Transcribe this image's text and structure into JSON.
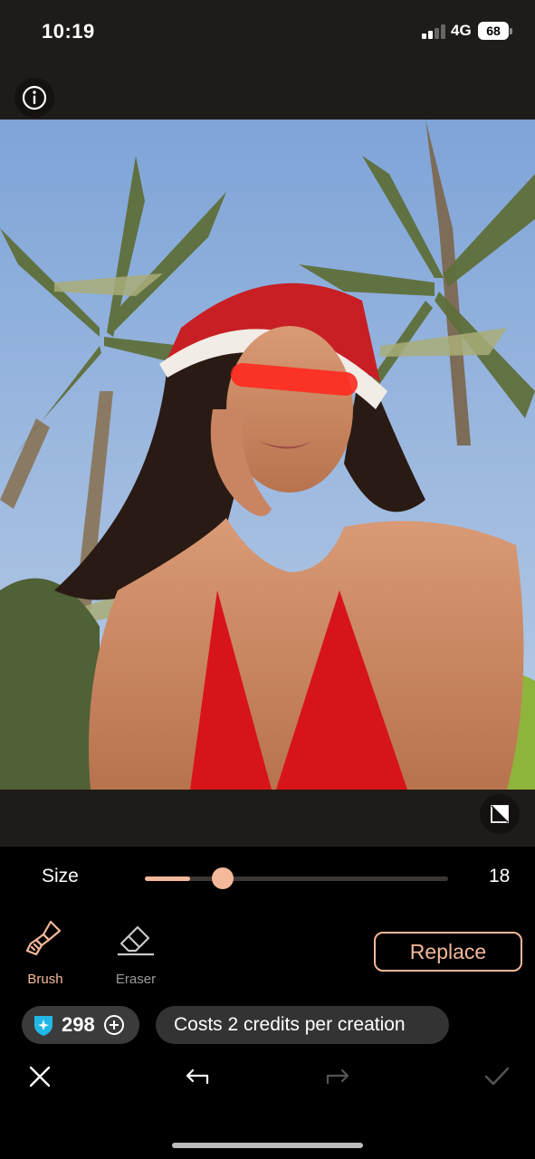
{
  "status_bar": {
    "time": "10:19",
    "network": "4G",
    "battery": "68"
  },
  "editor": {
    "info_icon": "info-circle-icon",
    "compare_icon": "compare-icon"
  },
  "size_control": {
    "label": "Size",
    "value": "18",
    "level": 0.15
  },
  "tools": {
    "brush_label": "Brush",
    "eraser_label": "Eraser",
    "active": "brush"
  },
  "replace_label": "Replace",
  "credits": {
    "balance": "298",
    "cost_text": "Costs 2 credits per creation"
  },
  "bottom_bar": {
    "close_icon": "close-icon",
    "undo_icon": "undo-icon",
    "redo_icon": "redo-icon",
    "confirm_icon": "check-icon"
  },
  "colors": {
    "accent": "#f4b89a",
    "mask": "#ff2a1f",
    "panel": "#1f1b19"
  }
}
